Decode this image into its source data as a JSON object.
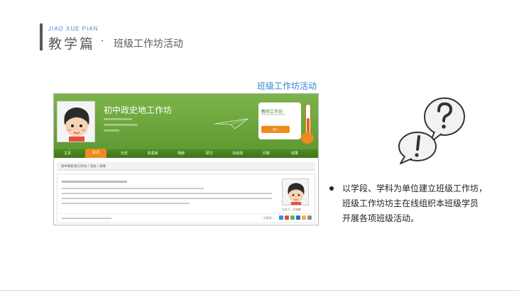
{
  "header": {
    "pinyin": "JIAO XUE PIAN",
    "title": "教学篇",
    "separator": "·",
    "subtitle": "班级工作坊活动"
  },
  "caption": "班级工作坊活动",
  "screenshot": {
    "site_title": "初中政史地工作坊",
    "card": {
      "title": "教师工作坊",
      "button": "加入"
    },
    "nav": [
      "主页",
      "资讯",
      "日志",
      "资源库",
      "相册",
      "研讨",
      "坊动态",
      "问答",
      "成果"
    ],
    "active_nav": "资讯",
    "breadcrumb": "初中政史地工作坊 / 活动 / 详情",
    "host_label": "主持人：代海峰",
    "share_label": "分享到："
  },
  "bullet": {
    "lines": [
      "以学段、学科为单位建立班级工作坊，",
      "班级工作坊坊主在线组织本班级学员",
      "开展各项班级活动。"
    ]
  },
  "colors": {
    "accent_blue": "#2f86d0",
    "banner_green": "#6aa63c",
    "nav_orange": "#f08a1c",
    "header_gray": "#555a60"
  },
  "icons": [
    "question-bubble-icon",
    "exclamation-bubble-icon",
    "paper-plane-icon"
  ]
}
